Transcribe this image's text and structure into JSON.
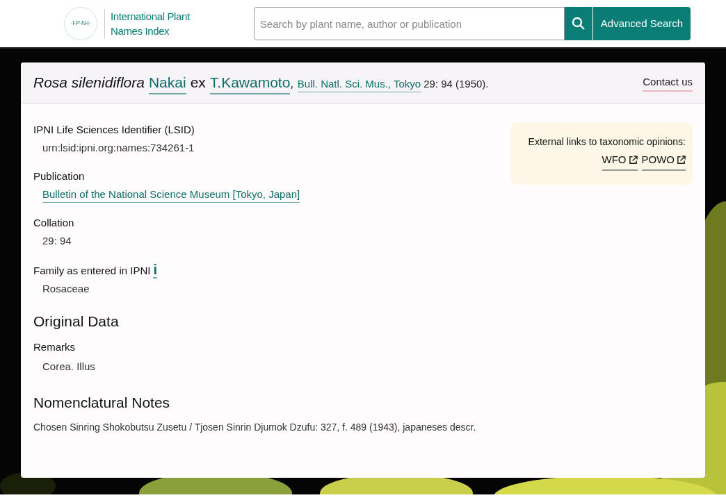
{
  "header": {
    "logo_text": "·I·P·N·I·",
    "site_name": [
      "International Plant",
      "Names Index"
    ],
    "search": {
      "placeholder": "Search by plant name, author or publication"
    },
    "advanced_search": "Advanced Search"
  },
  "record": {
    "name": "Rosa silenidiflora",
    "author_1": "Nakai",
    "connector": "ex",
    "author_2": "T.Kawamoto",
    "separator": ",",
    "publication_link": "Bull. Natl. Sci. Mus., Tokyo",
    "citation": "29: 94 (1950).",
    "contact": "Contact us"
  },
  "fields": [
    {
      "kind": "text",
      "label": "IPNI Life Sciences Identifier (LSID)",
      "value": "urn:lsid:ipni.org:names:734261-1"
    },
    {
      "kind": "link",
      "label": "Publication",
      "value": "Bulletin of the National Science Museum [Tokyo, Japan]"
    },
    {
      "kind": "text",
      "label": "Collation",
      "value": "29: 94"
    },
    {
      "kind": "info",
      "label": "Family as entered in IPNI",
      "info": "i",
      "value": "Rosaceae"
    }
  ],
  "external": {
    "title": "External links to taxonomic opinions:",
    "links": [
      "WFO",
      "POWO"
    ]
  },
  "original_data": {
    "heading": "Original Data",
    "label": "Remarks",
    "value": "Corea. Illus"
  },
  "notes": {
    "heading": "Nomenclatural Notes",
    "text": "Chosen Sinring Shokobutsu Zusetu / Tjosen Sinrin Djumok Dzufu: 327, f. 489 (1943), japaneses descr."
  }
}
